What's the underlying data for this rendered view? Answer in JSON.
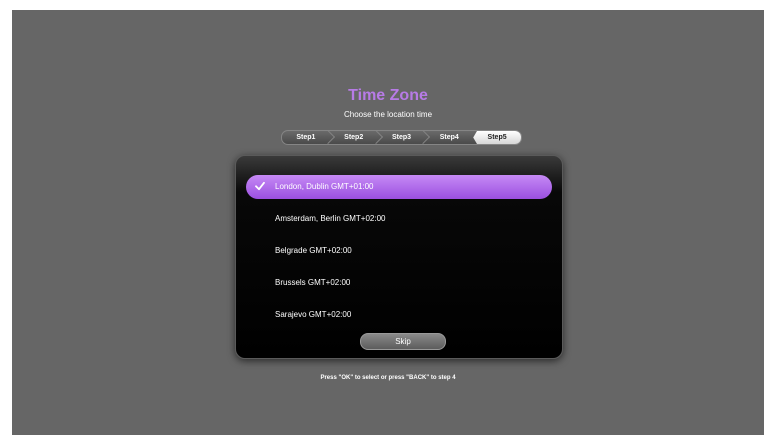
{
  "wizard": {
    "title": "Time Zone",
    "subtitle": "Choose the location time",
    "steps": [
      {
        "label": "Step1",
        "active": false
      },
      {
        "label": "Step2",
        "active": false
      },
      {
        "label": "Step3",
        "active": false
      },
      {
        "label": "Step4",
        "active": false
      },
      {
        "label": "Step5",
        "active": true
      }
    ]
  },
  "timezones": [
    {
      "label": "London, Dublin GMT+01:00",
      "selected": true
    },
    {
      "label": "Amsterdam, Berlin GMT+02:00",
      "selected": false
    },
    {
      "label": "Belgrade GMT+02:00",
      "selected": false
    },
    {
      "label": "Brussels GMT+02:00",
      "selected": false
    },
    {
      "label": "Sarajevo GMT+02:00",
      "selected": false
    }
  ],
  "skip_label": "Skip",
  "hint": "Press \"OK\" to select or press \"BACK\" to step 4",
  "colors": {
    "accent": "#b77be6",
    "selection": "#a35be6",
    "background": "#666666",
    "panel": "#000000"
  },
  "icons": {
    "selected_marker": "check-icon"
  }
}
